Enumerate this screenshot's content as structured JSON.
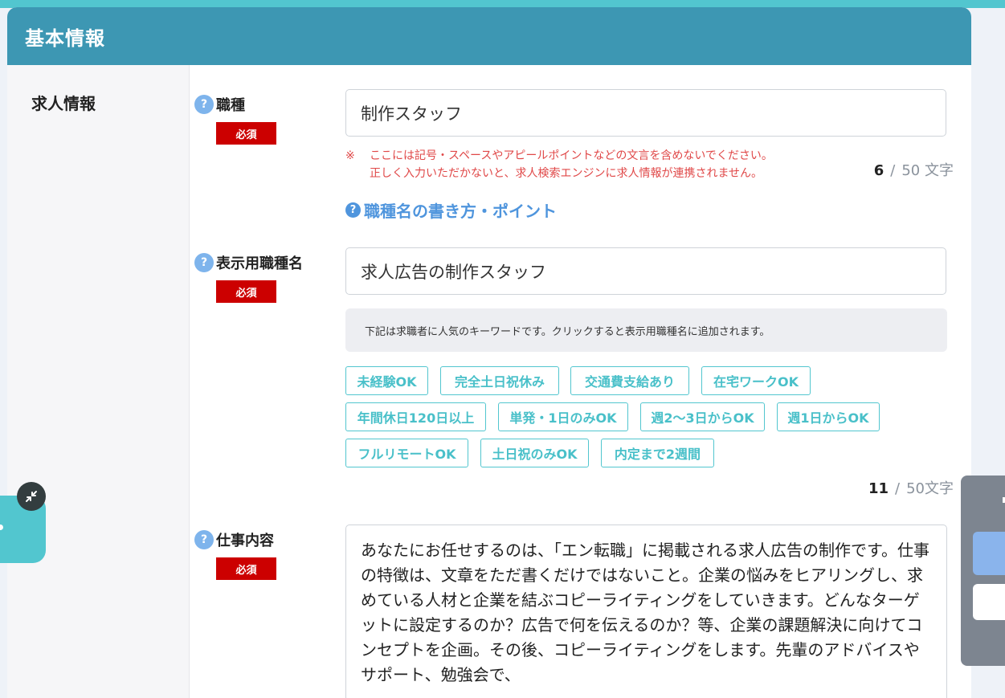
{
  "header": {
    "title": "基本情報"
  },
  "section": {
    "title": "求人情報"
  },
  "help_glyph": "?",
  "required_label": "必須",
  "job_type": {
    "label": "職種",
    "value": "制作スタッフ",
    "notice_mark": "※",
    "notice_line1": "ここには記号・スペースやアピールポイントなどの文言を含めないでください。",
    "notice_line2": "正しく入力いただかないと、求人検索エンジンに求人情報が連携されません。",
    "count": "6",
    "separator": "/",
    "limit": "50 文字",
    "help_link": "職種名の書き方・ポイント"
  },
  "display_name": {
    "label": "表示用職種名",
    "value": "求人広告の制作スタッフ",
    "hint": "下記は求職者に人気のキーワードです。クリックすると表示用職種名に追加されます。",
    "keywords": [
      "未経験OK",
      "完全土日祝休み",
      "交通費支給あり",
      "在宅ワークOK",
      "年間休日120日以上",
      "単発・1日のみOK",
      "週2〜3日からOK",
      "週1日からOK",
      "フルリモートOK",
      "土日祝のみOK",
      "内定まで2週間"
    ],
    "count": "11",
    "separator": "/",
    "limit": "50文字"
  },
  "job_description": {
    "label": "仕事内容",
    "value": "あなたにお任せするのは、「エン転職」に掲載される求人広告の制作です。仕事の特徴は、文章をただ書くだけではないこと。企業の悩みをヒアリングし、求めている人材と企業を結ぶコピーライティングをしていきます。どんなターゲットに設定するのか？広告で何を伝えるのか？等、企業の課題解決に向けてコンセプトを企画。その後、コピーライティングをします。先輩のアドバイスやサポート、勉強会で、"
  },
  "colors": {
    "header_bg": "#3d97b3",
    "accent_teal": "#52c6cf",
    "required_red": "#cc0000",
    "notice_red": "#e04848",
    "link_blue": "#4f95dd"
  }
}
